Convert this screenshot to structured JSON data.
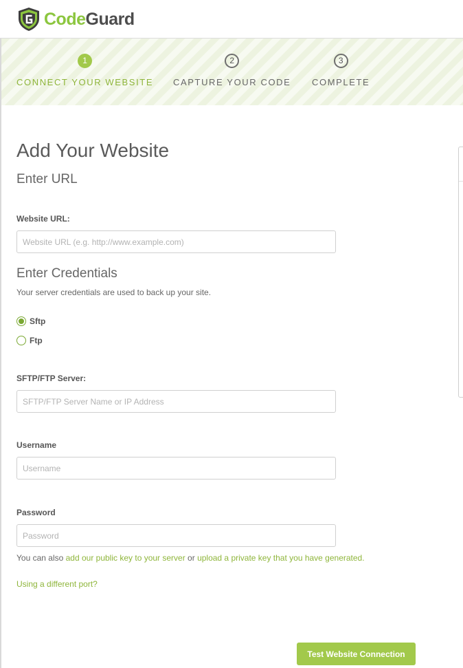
{
  "brand": {
    "name_part1": "Code",
    "name_part2": "Guard",
    "accent": "#8cc63f",
    "icon": "shield-g-logo-icon"
  },
  "steps": [
    {
      "number": "1",
      "label": "CONNECT YOUR WEBSITE",
      "active": true
    },
    {
      "number": "2",
      "label": "CAPTURE YOUR CODE",
      "active": false
    },
    {
      "number": "3",
      "label": "COMPLETE",
      "active": false
    }
  ],
  "page_title": "Add Your Website",
  "url_section": {
    "heading": "Enter URL",
    "label": "Website URL:",
    "placeholder": "Website URL (e.g. http://www.example.com)"
  },
  "credentials": {
    "heading": "Enter Credentials",
    "subtext": "Your server credentials are used to back up your site.",
    "protocols": [
      {
        "label": "Sftp",
        "selected": true
      },
      {
        "label": "Ftp",
        "selected": false
      }
    ],
    "server_label": "SFTP/FTP Server:",
    "server_placeholder": "SFTP/FTP Server Name or IP Address",
    "username_label": "Username",
    "username_placeholder": "Username",
    "password_label": "Password",
    "password_placeholder": "Password"
  },
  "key_note": {
    "prefix": "You can also ",
    "link1": "add our public key to your server",
    "middle": " or ",
    "link2": "upload a private key that you have generated."
  },
  "port_link": "Using a different port?",
  "submit_label": "Test Website Connection",
  "colors": {
    "primary_green": "#a2c94b",
    "link_green": "#8eb53a"
  }
}
